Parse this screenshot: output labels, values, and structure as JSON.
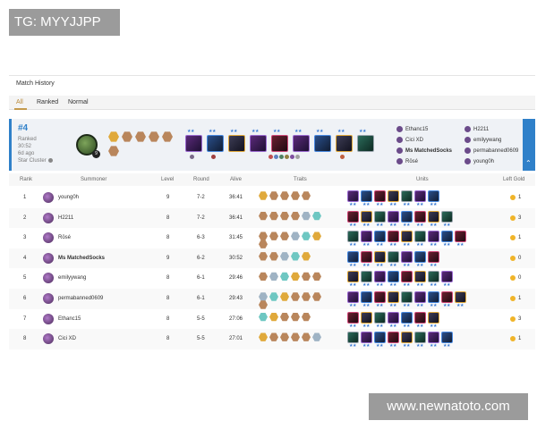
{
  "watermarks": {
    "top_left": "TG: MYYJJPP",
    "bottom_right": "www.newnatoto.com"
  },
  "panel": {
    "title": "Match History"
  },
  "tabs": [
    {
      "label": "All",
      "active": true
    },
    {
      "label": "Ranked",
      "active": false
    },
    {
      "label": "Normal",
      "active": false
    }
  ],
  "summary": {
    "placement": "#4",
    "mode": "Ranked",
    "duration": "30:52",
    "time_ago": "6d ago",
    "set_name": "Star Cluster",
    "level": "9",
    "participants_left": [
      "Ethanc15",
      "Cici XD",
      "Ms MatchedSocks",
      "Rōsé"
    ],
    "participants_right": [
      "H2211",
      "emilyywang",
      "permabanned0609",
      "young0h"
    ],
    "bold_participant": "Ms MatchedSocks",
    "unit_stars": [
      "★★",
      "★★",
      "★★",
      "★★",
      "★★",
      "★★",
      "★★",
      "★★",
      "★★"
    ]
  },
  "table": {
    "headers": [
      "Rank",
      "Summoner",
      "Level",
      "Round",
      "Alive",
      "Traits",
      "Units",
      "Left Gold"
    ],
    "rows": [
      {
        "rank": "1",
        "summoner": "young0h",
        "level": "9",
        "round": "7-2",
        "alive": "36:41",
        "gold": "1",
        "bold": false
      },
      {
        "rank": "2",
        "summoner": "H2211",
        "level": "8",
        "round": "7-2",
        "alive": "36:41",
        "gold": "3",
        "bold": false
      },
      {
        "rank": "3",
        "summoner": "Rōsé",
        "level": "8",
        "round": "6-3",
        "alive": "31:45",
        "gold": "1",
        "bold": false
      },
      {
        "rank": "4",
        "summoner": "Ms MatchedSocks",
        "level": "9",
        "round": "6-2",
        "alive": "30:52",
        "gold": "0",
        "bold": true
      },
      {
        "rank": "5",
        "summoner": "emilyywang",
        "level": "8",
        "round": "6-1",
        "alive": "29:46",
        "gold": "0",
        "bold": false
      },
      {
        "rank": "6",
        "summoner": "permabanned0609",
        "level": "8",
        "round": "6-1",
        "alive": "29:43",
        "gold": "1",
        "bold": false
      },
      {
        "rank": "7",
        "summoner": "Ethanc15",
        "level": "8",
        "round": "5-5",
        "alive": "27:06",
        "gold": "3",
        "bold": false
      },
      {
        "rank": "8",
        "summoner": "Cici XD",
        "level": "8",
        "round": "5-5",
        "alive": "27:01",
        "gold": "1",
        "bold": false
      }
    ]
  },
  "colors": {
    "accent": "#2f80c9",
    "tab_active": "#b98a3a",
    "gold": "#f0b429"
  }
}
